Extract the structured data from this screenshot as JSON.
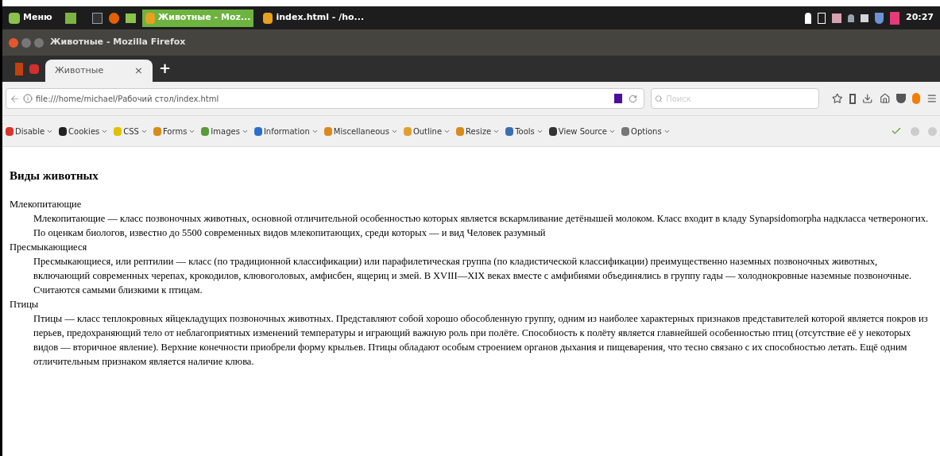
{
  "taskbar": {
    "menu_label": "Меню",
    "windows": [
      {
        "label": "Животные - Moz...",
        "selected": true
      },
      {
        "label": "index.html - /ho...",
        "selected": false
      }
    ],
    "clock": "20:27"
  },
  "window": {
    "title": "Животные - Mozilla Firefox"
  },
  "tabs": [
    {
      "label": "Животные",
      "selected": true,
      "close": "×"
    }
  ],
  "new_tab": "+",
  "address_bar": {
    "url": "file:///home/michael/Рабочий стол/index.html"
  },
  "search": {
    "placeholder": "Поиск"
  },
  "dev_toolbar": {
    "items": [
      "Disable",
      "Cookies",
      "CSS",
      "Forms",
      "Images",
      "Information",
      "Miscellaneous",
      "Outline",
      "Resize",
      "Tools",
      "View Source",
      "Options"
    ]
  },
  "page": {
    "heading": "Виды животных",
    "entries": [
      {
        "term": "Млекопитающие",
        "definition": "Млекопитающие — класс позвоночных животных, основной отличительной особенностью которых является вскармливание детёнышей молоком. Класс входит в кладу Synapsidomorpha надкласса четвероногих. По оценкам биологов, известно до 5500 современных видов млекопитающих, среди которых — и вид Человек разумный"
      },
      {
        "term": "Пресмыкающиеся",
        "definition": "Пресмыкающиеся, или рептилии — класс (по традиционной классификации) или парафилетическая группа (по кладистической классификации) преимущественно наземных позвоночных животных, включающий современных черепах, крокодилов, клювоголовых, амфисбен, ящериц и змей. В XVIII—XIX веках вместе с амфибиями объединялись в группу гады — холоднокровные наземные позвоночные. Считаются самыми близкими к птицам."
      },
      {
        "term": "Птицы",
        "definition": "Птицы — класс теплокровных яйцекладущих позвоночных животных. Представляют собой хорошо обособленную группу, одним из наиболее характерных признаков представителей которой является покров из перьев, предохраняющий тело от неблагоприятных изменений температуры и играющий важную роль при полёте. Способность к полёту является главнейшей особенностью птиц (отсутствие её у некоторых видов — вторичное явление). Верхние конечности приобрели форму крыльев. Птицы обладают особым строением органов дыхания и пищеварения, что тесно связано с их способностью летать. Ещё одним отличительным признаком является наличие клюва."
      }
    ]
  }
}
